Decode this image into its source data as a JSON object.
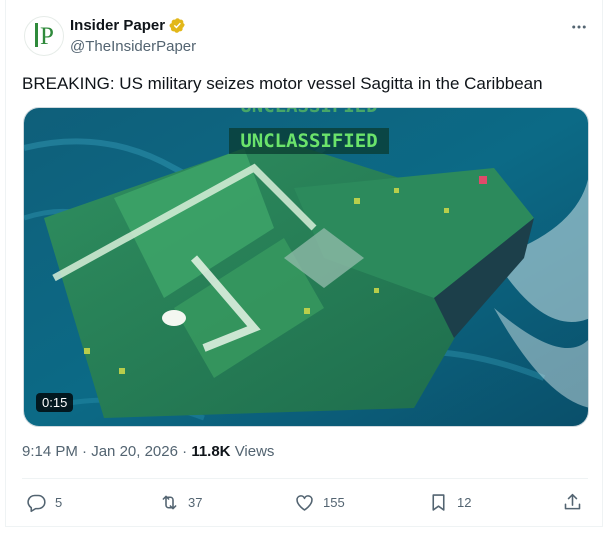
{
  "author": {
    "display_name": "Insider Paper",
    "handle": "@TheInsiderPaper",
    "avatar_text": "IP",
    "verified_icon": "verified-badge-icon",
    "verified_color": "#e2b719"
  },
  "post": {
    "text": "BREAKING: US military seizes motor vessel Sagitta in the Caribbean",
    "media": {
      "type": "video",
      "duration": "0:15",
      "overlay_text": "UNCLASSIFIED",
      "overlay_text_partial": "UNCLASSIFIED"
    },
    "time": "9:14 PM",
    "separator": "·",
    "date": "Jan 20, 2026",
    "views_count": "11.8K",
    "views_label": "Views"
  },
  "actions": {
    "reply": {
      "icon": "reply-icon",
      "count": "5"
    },
    "repost": {
      "icon": "repost-icon",
      "count": "37"
    },
    "like": {
      "icon": "heart-icon",
      "count": "155"
    },
    "bookmark": {
      "icon": "bookmark-icon",
      "count": "12"
    },
    "share": {
      "icon": "share-icon"
    }
  },
  "more_menu": {
    "icon": "more-horizontal-icon"
  },
  "colors": {
    "text": "#0f1419",
    "muted": "#536471",
    "border": "#eff3f4",
    "brand_green": "#2f8a3b"
  }
}
